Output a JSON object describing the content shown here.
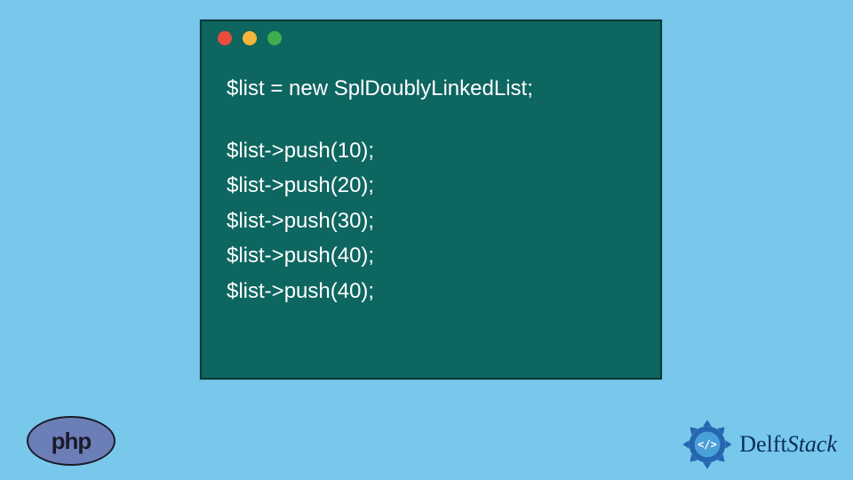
{
  "colors": {
    "canvas_bg": "#78c8ec",
    "window_bg": "#0e6660",
    "window_border": "#003a36",
    "dot_red": "#e94b3c",
    "dot_yellow": "#f3b53b",
    "dot_green": "#3fae4e",
    "code_text": "#ffffff",
    "php_bg": "#6c7eb7",
    "php_text": "#1b1b2a",
    "delft_text": "#0a2e5c"
  },
  "code": {
    "line1": "$list = new SplDoublyLinkedList;",
    "line2": "$list->push(10);",
    "line3": "$list->push(20);",
    "line4": "$list->push(30);",
    "line5": "$list->push(40);",
    "line6": "$list->push(40);"
  },
  "logos": {
    "php_label": "php",
    "delft_prefix": "Delft",
    "delft_suffix": "Stack"
  }
}
